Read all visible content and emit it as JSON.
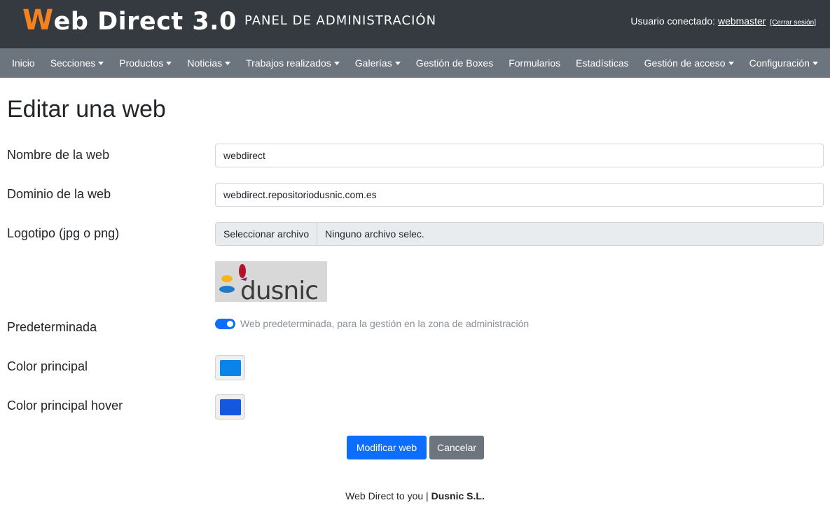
{
  "header": {
    "brand_initial": "W",
    "brand_rest": "eb Direct 3.0",
    "panel_title": "PANEL DE ADMINISTRACIÓN",
    "user_prefix": "Usuario conectado: ",
    "username": "webmaster",
    "logout": "[Cerrar sesión]"
  },
  "nav": {
    "items": [
      {
        "label": "Inicio",
        "dropdown": false
      },
      {
        "label": "Secciones",
        "dropdown": true
      },
      {
        "label": "Productos",
        "dropdown": true
      },
      {
        "label": "Noticias",
        "dropdown": true
      },
      {
        "label": "Trabajos realizados",
        "dropdown": true
      },
      {
        "label": "Galerías",
        "dropdown": true
      },
      {
        "label": "Gestión de Boxes",
        "dropdown": false
      },
      {
        "label": "Formularios",
        "dropdown": false
      },
      {
        "label": "Estadísticas",
        "dropdown": false
      },
      {
        "label": "Gestión de acceso",
        "dropdown": true
      },
      {
        "label": "Configuración",
        "dropdown": true
      }
    ]
  },
  "page": {
    "title": "Editar una web"
  },
  "form": {
    "name_label": "Nombre de la web",
    "name_value": "webdirect",
    "domain_label": "Dominio de la web",
    "domain_value": "webdirect.repositoriodusnic.com.es",
    "logo_label": "Logotipo (jpg o png)",
    "file_button": "Seleccionar archivo",
    "file_name": "Ninguno archivo selec.",
    "logo_text": "dusnic",
    "default_label": "Predeterminada",
    "default_checked": true,
    "default_description": "Web predeterminada, para la gestión en la zona de administración",
    "color_label": "Color principal",
    "color_value": "#0a84e8",
    "color_hover_label": "Color principal hover",
    "color_hover_value": "#1558e0",
    "submit_label": "Modificar web",
    "cancel_label": "Cancelar"
  },
  "footer": {
    "text": "Web Direct to you | ",
    "company": "Dusnic S.L."
  }
}
